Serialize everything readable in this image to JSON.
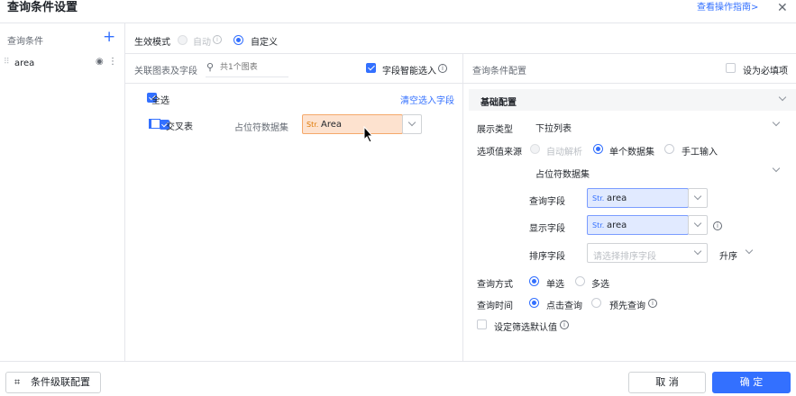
{
  "header": {
    "title": "查询条件设置",
    "guide_link": "查看操作指南>"
  },
  "left_panel": {
    "title": "查询条件",
    "add_icon": "plus-icon",
    "items": [
      {
        "label": "area"
      }
    ]
  },
  "mode": {
    "label": "生效模式",
    "options": [
      {
        "label": "自动",
        "selected": false,
        "disabled": true
      },
      {
        "label": "自定义",
        "selected": true,
        "disabled": false
      }
    ]
  },
  "middle": {
    "header_label": "关联图表及字段",
    "search_placeholder": "共1个图表",
    "smart_select_label": "字段智能选入",
    "smart_select_checked": true,
    "select_all_label": "全选",
    "clear_link": "清空选入字段",
    "charts": [
      {
        "name": "交叉表",
        "checked": true,
        "dataset_label": "占位符数据集",
        "field_type": "Str.",
        "field": "Area"
      }
    ]
  },
  "right": {
    "header_label": "查询条件配置",
    "required_label": "设为必填项",
    "section_title": "基础配置",
    "display_type_label": "展示类型",
    "display_type_value": "下拉列表",
    "source_label": "选项值来源",
    "source_options": [
      {
        "label": "自动解析",
        "selected": false,
        "disabled": true
      },
      {
        "label": "单个数据集",
        "selected": true,
        "disabled": false
      },
      {
        "label": "手工输入",
        "selected": false,
        "disabled": false
      }
    ],
    "dataset_value": "占位符数据集",
    "query_field_label": "查询字段",
    "query_field_type": "Str.",
    "query_field_value": "area",
    "display_field_label": "显示字段",
    "display_field_type": "Str.",
    "display_field_value": "area",
    "sort_field_label": "排序字段",
    "sort_field_placeholder": "请选择排序字段",
    "sort_order_value": "升序",
    "query_mode_label": "查询方式",
    "query_mode_options": [
      {
        "label": "单选",
        "selected": true
      },
      {
        "label": "多选",
        "selected": false
      }
    ],
    "query_time_label": "查询时间",
    "query_time_options": [
      {
        "label": "点击查询",
        "selected": true
      },
      {
        "label": "预先查询",
        "selected": false
      }
    ],
    "default_value_label": "设定筛选默认值"
  },
  "footer": {
    "cascade_label": "条件级联配置",
    "cancel_label": "取 消",
    "confirm_label": "确 定"
  },
  "colors": {
    "accent": "#3370ff",
    "border": "#e5e6eb"
  }
}
